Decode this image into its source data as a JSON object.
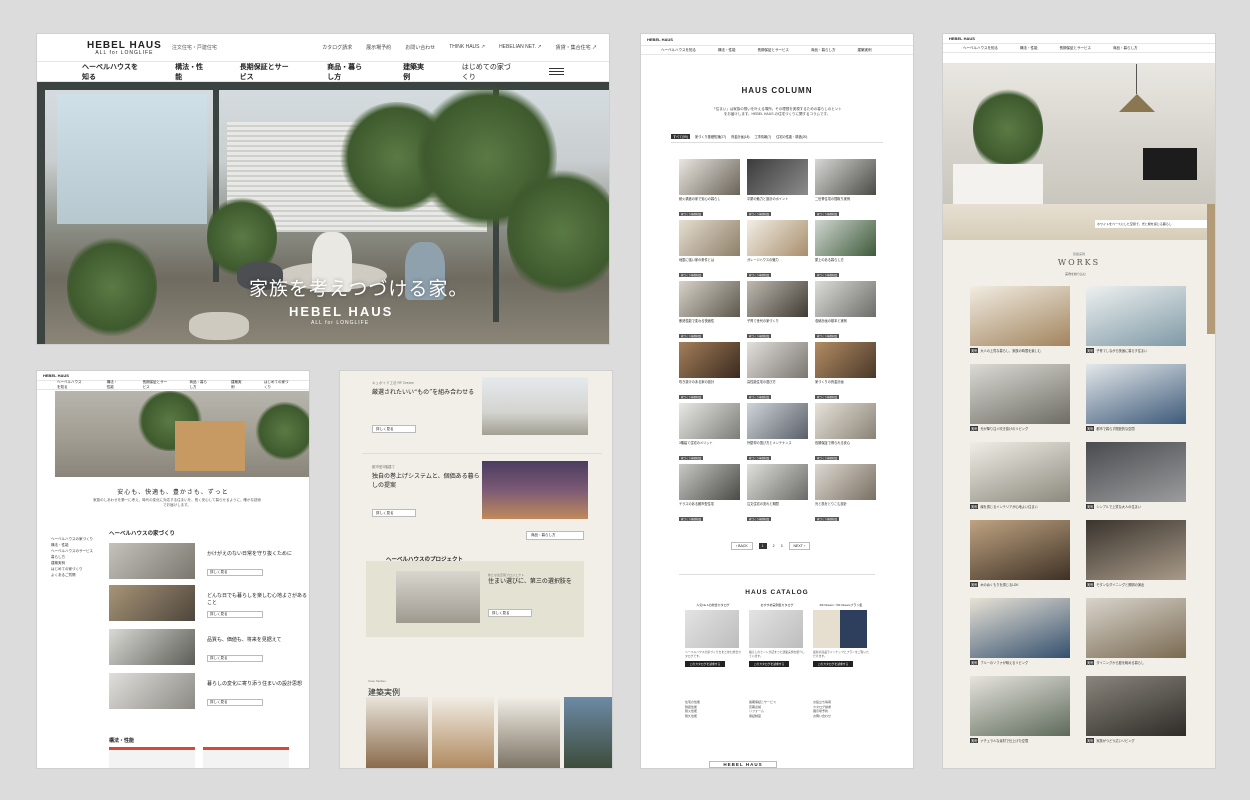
{
  "panelA": {
    "logo": "HEBEL HAUS",
    "logo_sub": "ALL for LONGLIFE",
    "tagline": "注文住宅・戸建住宅",
    "utils": [
      "カタログ請求",
      "展示場予約",
      "お問い合わせ",
      "THINK HAUS ↗",
      "HEBELIAN NET. ↗",
      "賃貸・集合住宅 ↗"
    ],
    "nav": [
      "ヘーベルハウスを知る",
      "構法・性能",
      "長期保証とサービス",
      "商品・暮らし方",
      "建築実例",
      "はじめての家づくり"
    ],
    "hero_copy": "家族を考えつづける家。",
    "hero_brand": "HEBEL HAUS",
    "hero_sub": "ALL for LONGLIFE"
  },
  "panelB": {
    "quote": "安心も、快適も、豊かさも、ずっと",
    "quote_sub": "家族のしあわせを第一に考え、時代の変化に対応する住まいを、長く安心して暮らせるように、確かな技術でお届けします。",
    "side": [
      "ヘーベルハウスの家づくり",
      "構法・性能",
      "ヘーベルハウスのサービス",
      "暮らし方",
      "建築実例",
      "はじめての家づくり",
      "よくあるご質問"
    ],
    "section_title": "ヘーベルハウスの家づくり",
    "cards": [
      {
        "title": "かけがえのない日常を守り抜くために",
        "btn": "詳しく見る"
      },
      {
        "title": "どんな日でも暮らしを楽しむ心地よさがあること",
        "btn": "詳しく見る"
      },
      {
        "title": "品質も、価値も、将来を見据えて",
        "btn": "詳しく見る"
      },
      {
        "title": "暮らしの変化に寄り添う住まいの設計思想",
        "btn": "詳しく見る"
      }
    ],
    "section2_title": "構法・性能"
  },
  "panelC": {
    "blocks": [
      {
        "t1": "キュボイド工法 RF Dream",
        "t2": "厳選されたいい“もの”を組み合わせる",
        "btn": "詳しく見る"
      },
      {
        "t1": "都市型3階建て",
        "t2": "独自の巻上げシステムと、個価ある暮らしの提案",
        "btn": "詳しく見る"
      }
    ],
    "more_btn": "商品・暮らし方",
    "proj_title": "ヘーベルハウスのプロジェクト",
    "proj_sub": "新たな住空間プロジェクト",
    "proj_t": "住まい選びに、第三の選択肢を",
    "proj_btn": "詳しく見る",
    "works_sub": "Case Studies",
    "works_title": "建築実例"
  },
  "panelD": {
    "title": "HAUS COLUMN",
    "intro": "「住まい」は家族の想いを叶える場所。その理想を実現するための暮らしのヒントをお届けします。HEBEL HAUS の住宅づくりに関するコラムです。",
    "tabs": [
      "すべて(99)",
      "家づくり基礎知識(27)",
      "資金計画(18)",
      "工事情報(7)",
      "住宅の性能・構造(20)"
    ],
    "cells": [
      "耐火構造の家で安心の暮らし",
      "平屋の魅力と設計のポイント",
      "二世帯住宅の間取り実例",
      "地震に強い家の条件とは",
      "ガレージハウスの魅力",
      "屋上のある暮らし方",
      "断熱性能で変わる快適性",
      "子育て世代の家づくり",
      "収納計画の基本と実例",
      "吹き抜けのある家の設計",
      "高性能住宅の選び方",
      "家づくりの資金計画",
      "3階建て住宅のメリット",
      "外壁材の選び方とメンテナンス",
      "長期保証で得られる安心",
      "テラスのある都市型住宅",
      "注文住宅の流れと期間",
      "光と風をとりこむ設計"
    ],
    "tag": "家づくり基礎知識",
    "pager": [
      "‹ BACK",
      "1",
      "2",
      "3",
      "NEXT ›"
    ],
    "catalog_title": "HAUS CATALOG",
    "catalog": [
      {
        "name": "人気No.1の総合カタログ",
        "desc": "ヘーベルハウスの家づくりをまとめた総合カタログです。",
        "btn": "このカタログを請求する"
      },
      {
        "name": "おすすめ実例集カタログ",
        "desc": "暮らしのヒントが詰まった建築実例を紹介しています。",
        "btn": "このカタログを請求する"
      },
      {
        "name": "RF Dream・RF Dreamプラン集",
        "desc": "最新の商品ラインナップとプランをご覧いただけます。",
        "btn": "このカタログを請求する"
      }
    ],
    "footer_cols": [
      [
        "住宅の性能",
        "耐震性能",
        "耐火性能",
        "耐久性能"
      ],
      [
        "長期保証とサービス",
        "定期点検",
        "リフォーム",
        "保証制度"
      ],
      [
        "お役立ち情報",
        "カタログ請求",
        "展示場予約",
        "お問い合わせ"
      ]
    ],
    "footer_logo": "HEBEL HAUS"
  },
  "panelE": {
    "caption": "ホワイトをベースにした空間で、光と緑を感じる暮らし",
    "works_sub": "建築実例",
    "works_title": "WORKS",
    "filter": "実例を絞り込む",
    "items": [
      "大人の上質な暮らし、家族の時間を楽しむ",
      "子育てしながら快適に暮らす住まい",
      "光が降り注ぐ吹き抜けのリビング",
      "都市で暮らす開放的な空間",
      "緑を感じるインテリアが心地よい住まい",
      "シンプルで上質な大人の住まい",
      "木のぬくもりを感じるLDK",
      "モダンなダイニングと照明の演出",
      "ブルーのソファが映えるリビング",
      "ダイニングから庭を眺める暮らし",
      "ナチュラルな素材で仕上げた空間",
      "家族がつどう広いリビング"
    ],
    "item_tag": "実例"
  }
}
